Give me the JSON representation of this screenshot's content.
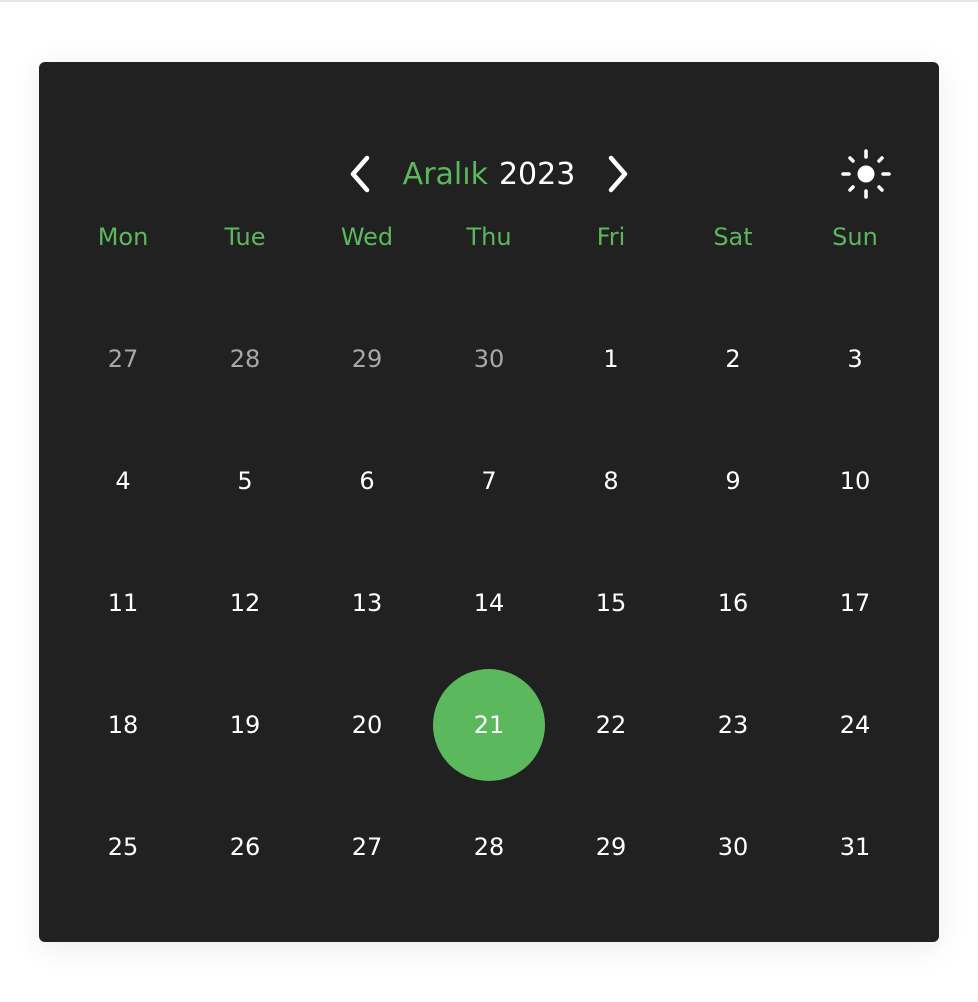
{
  "header": {
    "month": "Aralık",
    "year": "2023",
    "prev_icon": "chevron-left-icon",
    "next_icon": "chevron-right-icon",
    "theme_icon": "sun-icon"
  },
  "colors": {
    "accent": "#5cb85c",
    "background": "#212121",
    "text": "#ffffff",
    "muted_text": "#a8a8a8"
  },
  "weekdays": [
    "Mon",
    "Tue",
    "Wed",
    "Thu",
    "Fri",
    "Sat",
    "Sun"
  ],
  "weeks": [
    [
      {
        "d": "27",
        "muted": true
      },
      {
        "d": "28",
        "muted": true
      },
      {
        "d": "29",
        "muted": true
      },
      {
        "d": "30",
        "muted": true
      },
      {
        "d": "1"
      },
      {
        "d": "2"
      },
      {
        "d": "3"
      }
    ],
    [
      {
        "d": "4"
      },
      {
        "d": "5"
      },
      {
        "d": "6"
      },
      {
        "d": "7"
      },
      {
        "d": "8"
      },
      {
        "d": "9"
      },
      {
        "d": "10"
      }
    ],
    [
      {
        "d": "11"
      },
      {
        "d": "12"
      },
      {
        "d": "13"
      },
      {
        "d": "14"
      },
      {
        "d": "15"
      },
      {
        "d": "16"
      },
      {
        "d": "17"
      }
    ],
    [
      {
        "d": "18"
      },
      {
        "d": "19"
      },
      {
        "d": "20"
      },
      {
        "d": "21",
        "selected": true
      },
      {
        "d": "22"
      },
      {
        "d": "23"
      },
      {
        "d": "24"
      }
    ],
    [
      {
        "d": "25"
      },
      {
        "d": "26"
      },
      {
        "d": "27"
      },
      {
        "d": "28"
      },
      {
        "d": "29"
      },
      {
        "d": "30"
      },
      {
        "d": "31"
      }
    ]
  ]
}
